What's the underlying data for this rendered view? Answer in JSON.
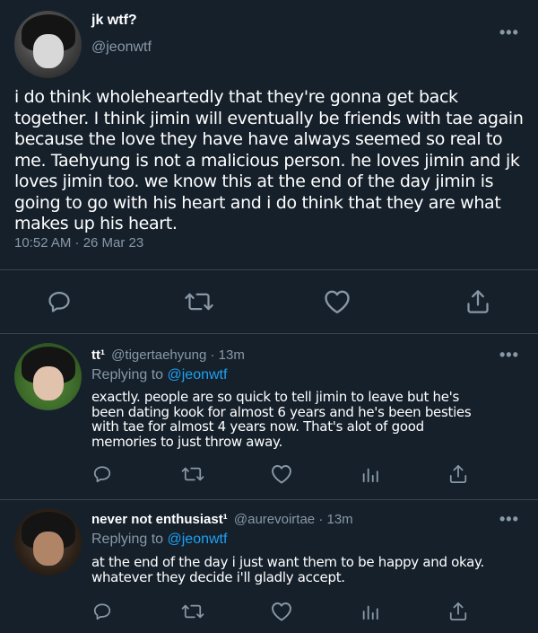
{
  "main_tweet": {
    "display_name": "jk wtf?",
    "handle": "@jeonwtf",
    "text": "i do think wholeheartedly that they're gonna get back together. I think jimin will eventually be friends with tae again because the love they have have always seemed so real to me. Taehyung is not a malicious person. he loves jimin and jk loves jimin too. we know this at the end of the day jimin is going to go with his heart and i do think that they are what makes up his heart.",
    "timestamp": "10:52 AM · 26 Mar 23",
    "more": "•••"
  },
  "replies": [
    {
      "display_name": "tt¹",
      "handle": "@tigertaehyung",
      "time": "· 13m",
      "replying_prefix": "Replying to ",
      "replying_to": "@jeonwtf",
      "text": "exactly. people are so quick to tell jimin to leave but he's been dating kook for almost 6 years and he's been besties with tae for almost 4 years now. That's alot of good memories to just throw away.",
      "more": "•••"
    },
    {
      "display_name": "never not enthusiast¹",
      "handle": "@aurevoirtae",
      "time": "· 13m",
      "replying_prefix": "Replying to ",
      "replying_to": "@jeonwtf",
      "text": "at the end of the day i just want them to be happy and okay. whatever they decide i'll gladly accept.",
      "more": "•••"
    }
  ],
  "colors": {
    "background": "#15202b",
    "secondary_text": "#8899a6",
    "link": "#1da1f2",
    "divider": "#38444d"
  },
  "icons": [
    "reply-icon",
    "retweet-icon",
    "like-icon",
    "analytics-icon",
    "share-icon",
    "more-icon"
  ]
}
